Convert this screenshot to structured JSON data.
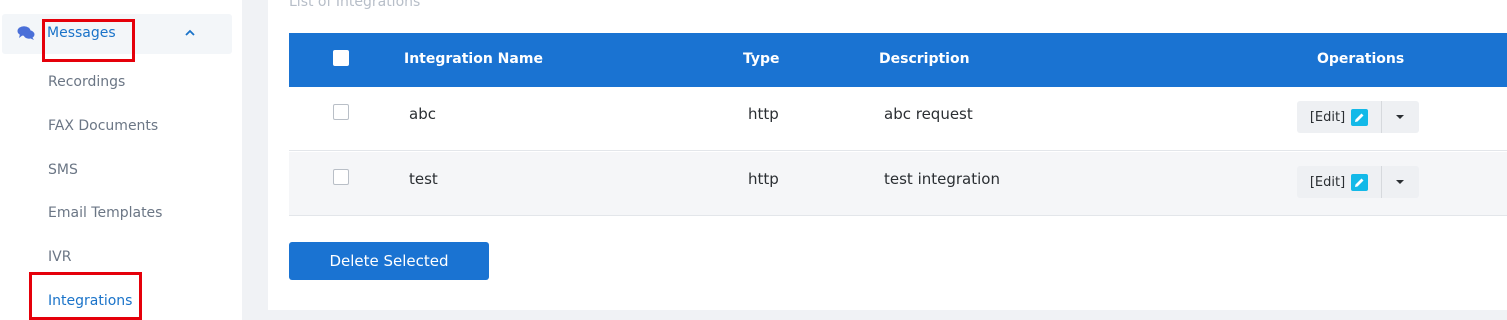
{
  "sidebar": {
    "parent": {
      "label": "Messages",
      "icon": "chat-icon",
      "expanded_icon": "chevron-up-icon"
    },
    "items": [
      {
        "label": "Recordings",
        "active": false
      },
      {
        "label": "FAX Documents",
        "active": false
      },
      {
        "label": "SMS",
        "active": false
      },
      {
        "label": "Email Templates",
        "active": false
      },
      {
        "label": "IVR",
        "active": false
      },
      {
        "label": "Integrations",
        "active": true
      }
    ]
  },
  "main": {
    "title": "List of Integrations",
    "table": {
      "columns": [
        "Integration Name",
        "Type",
        "Description",
        "Operations"
      ],
      "rows": [
        {
          "name": "abc",
          "type": "http",
          "description": "abc request",
          "action": "[Edit]"
        },
        {
          "name": "test",
          "type": "http",
          "description": "test integration",
          "action": "[Edit]"
        }
      ]
    },
    "delete_label": "Delete Selected"
  },
  "colors": {
    "accent": "#1a73d2",
    "highlight_box": "#e5000a",
    "edit_icon": "#13b9e8"
  }
}
